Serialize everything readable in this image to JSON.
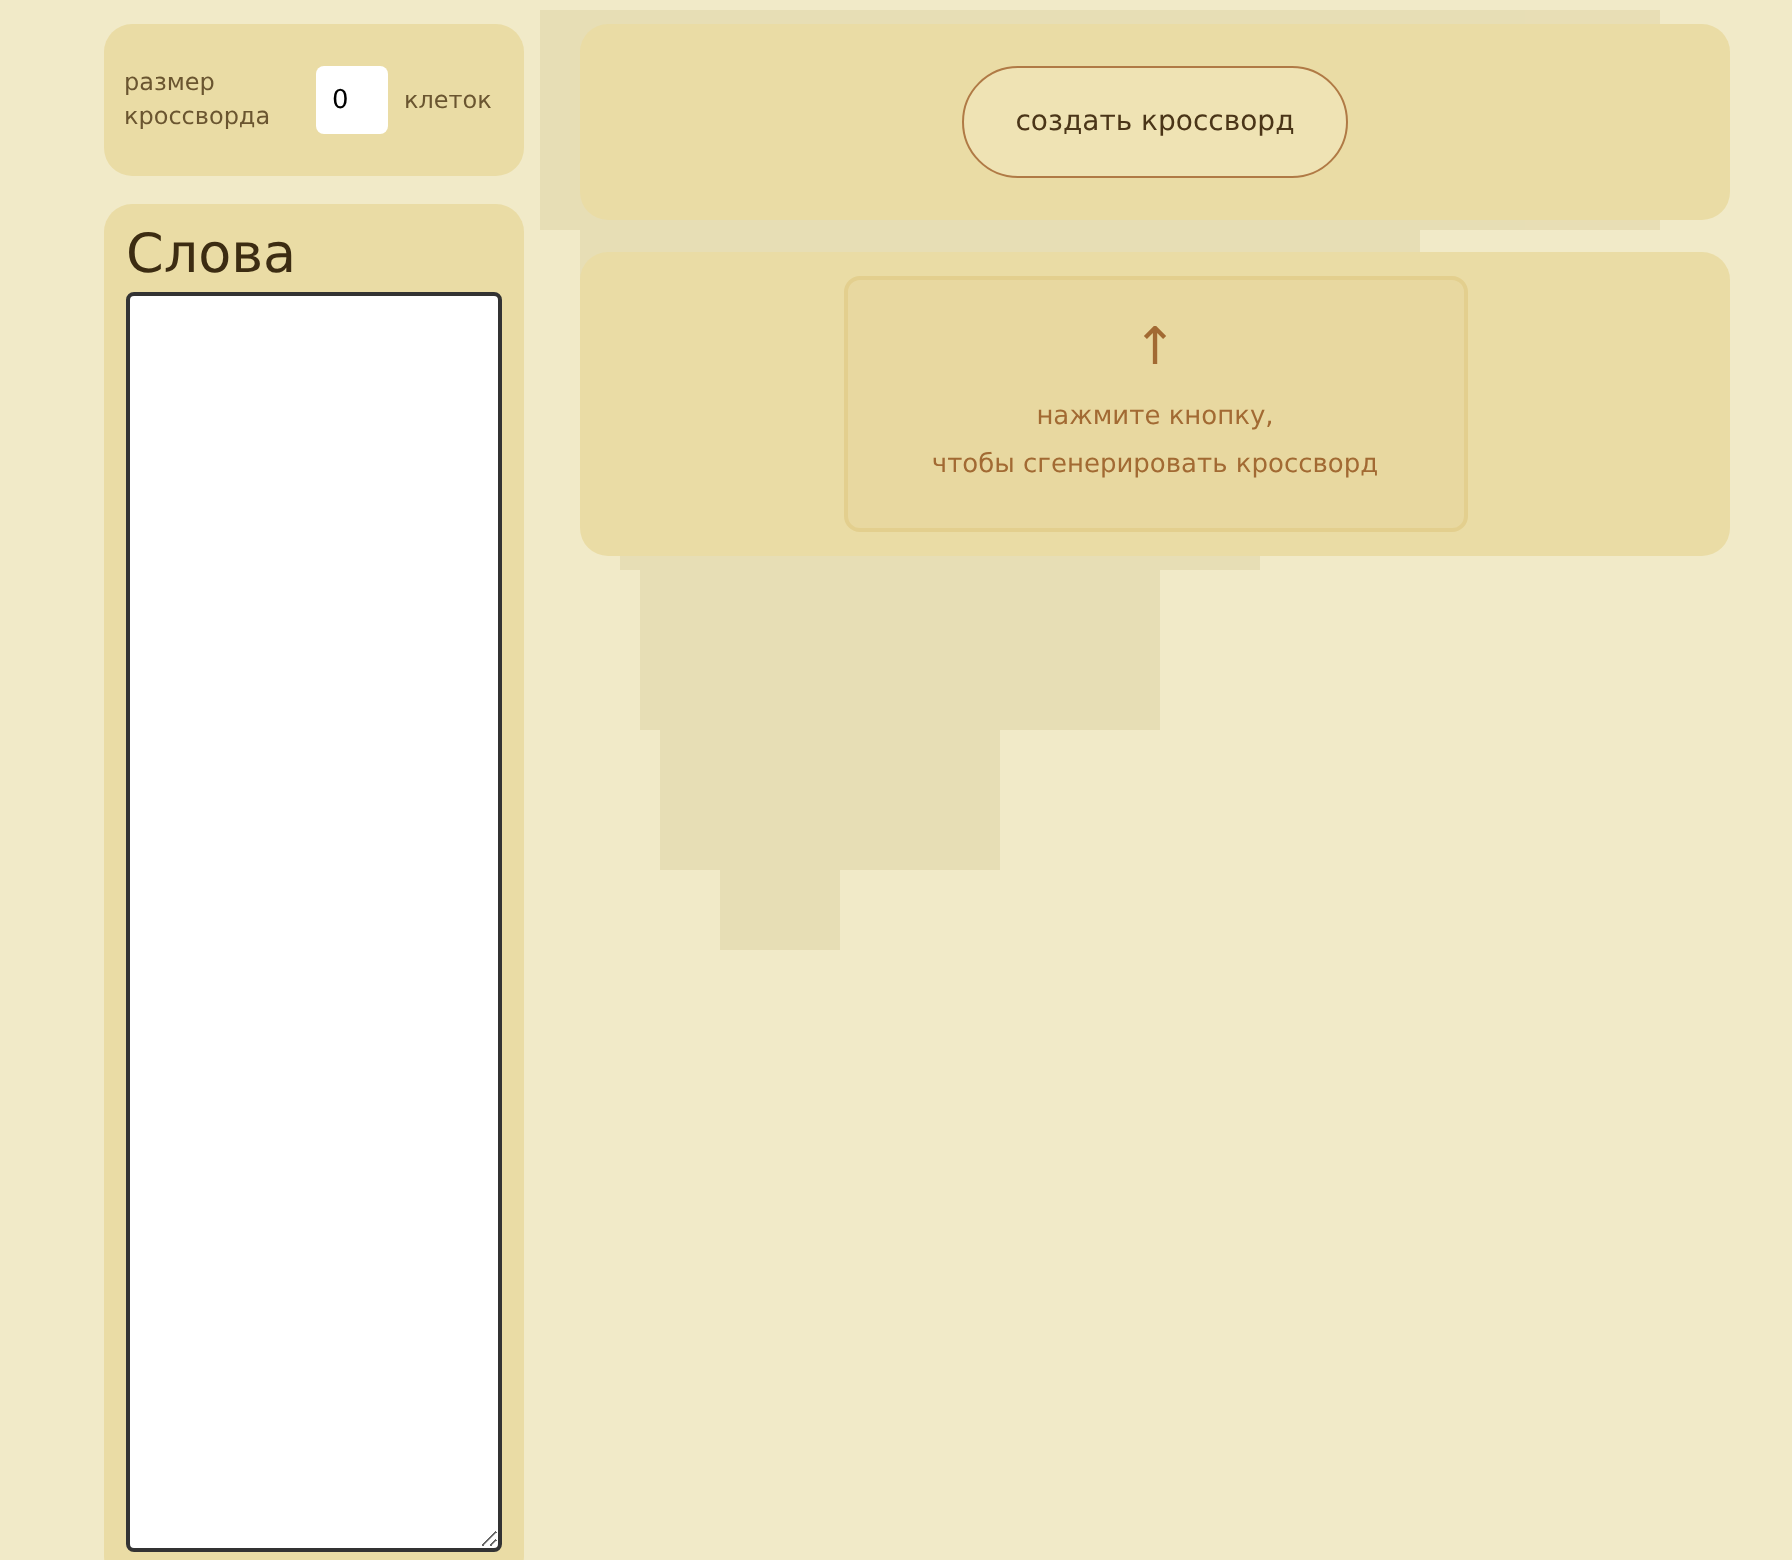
{
  "size": {
    "label": "размер кроссворда",
    "value": "0",
    "unit": "клеток"
  },
  "create_button": "создать кроссворд",
  "words": {
    "title": "Слова"
  },
  "hint": {
    "arrow": "↑",
    "lines": [
      "нажмите кнопку,",
      "чтобы сгенерировать кроссворд"
    ]
  }
}
